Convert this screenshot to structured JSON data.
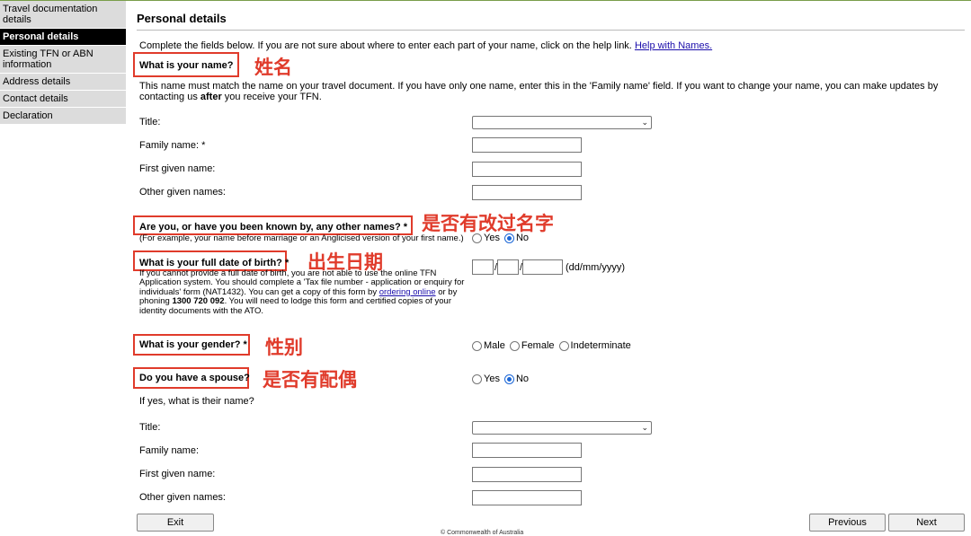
{
  "sidebar": {
    "items": [
      {
        "label": "Travel documentation details"
      },
      {
        "label": "Personal details"
      },
      {
        "label": "Existing TFN or ABN information"
      },
      {
        "label": "Address details"
      },
      {
        "label": "Contact details"
      },
      {
        "label": "Declaration"
      }
    ]
  },
  "page": {
    "title": "Personal details",
    "intro": "Complete the fields below. If you are not sure about where to enter each part of your name, click on the help link.",
    "help_link": "Help with Names."
  },
  "name_section": {
    "question": "What is your name?",
    "annotation": "姓名",
    "note_part1": "This name must match the name on your travel document. If you have only one name, enter this in the 'Family name' field. If you want to change your name, you can make updates by contacting us",
    "note_bold": "after",
    "note_part2": "you receive your TFN.",
    "title_label": "Title:",
    "title_value": "",
    "family_label": "Family name: *",
    "first_label": "First given name:",
    "other_label": "Other given names:"
  },
  "other_names": {
    "question": "Are you, or have you been known by, any other names? *",
    "annotation": "是否有改过名字",
    "hint": "(For example, your name before marriage or an Anglicised version of your first name.)",
    "options": [
      "Yes",
      "No"
    ],
    "selected": "No"
  },
  "dob": {
    "question": "What is your full date of birth? *",
    "annotation": "出生日期",
    "format": "(dd/mm/yyyy)",
    "separator": "/",
    "hint_part1": "If you cannot provide a full date of birth, you are not able to use the online TFN Application system. You should complete a 'Tax file number - application or enquiry for individuals' form (NAT1432). You can get a copy of this form by",
    "hint_link": "ordering online",
    "hint_part2": "or by phoning",
    "hint_phone": "1300 720 092",
    "hint_part3": ". You will need to lodge this form and certified copies of your identity documents with the ATO."
  },
  "gender": {
    "question": "What is your gender? *",
    "annotation": "性别",
    "options": [
      "Male",
      "Female",
      "Indeterminate"
    ],
    "selected": ""
  },
  "spouse": {
    "question": "Do you have a spouse?",
    "annotation": "是否有配偶",
    "options": [
      "Yes",
      "No"
    ],
    "selected": "No",
    "followup": "If yes, what is their name?",
    "title_label": "Title:",
    "family_label": "Family name:",
    "first_label": "First given name:",
    "other_label": "Other given names:"
  },
  "buttons": {
    "exit": "Exit",
    "previous": "Previous",
    "next": "Next"
  },
  "footer": "© Commonwealth of Australia",
  "colors": {
    "annotation": "#e03b2b",
    "link": "#1a0dab",
    "radio_checked": "#1a66d6"
  }
}
